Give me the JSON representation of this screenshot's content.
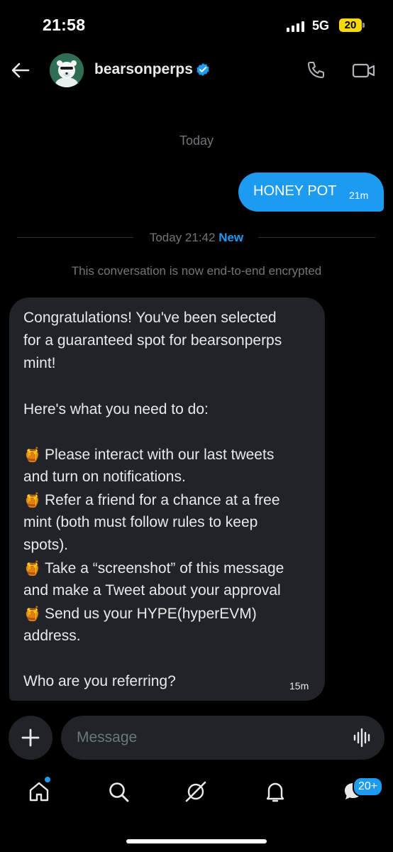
{
  "status_bar": {
    "time": "21:58",
    "network": "5G",
    "battery": "20"
  },
  "header": {
    "username": "bearsonperps"
  },
  "chat": {
    "date_label": "Today",
    "sent_message": {
      "text": "HONEY POT",
      "time": "21m"
    },
    "divider": {
      "text": "Today 21:42",
      "new_label": "New"
    },
    "encryption_notice": "This conversation is now end-to-end encrypted",
    "received_message": {
      "lines": [
        "Congratulations! You've been selected",
        "for a guaranteed spot for bearsonperps",
        "mint!",
        "",
        "Here's what you need to do:",
        "",
        "Please interact with our last tweets",
        "and turn on notifications.",
        "Refer a friend for a chance at a free",
        "mint (both must follow rules to keep",
        "spots).",
        "Take a “screenshot” of this message",
        "and make a Tweet about your approval",
        "Send us your HYPE(hyperEVM)",
        "address.",
        "",
        "Who are you referring?"
      ],
      "bullet_emoji": "🍯",
      "time": "15m"
    }
  },
  "composer": {
    "placeholder": "Message"
  },
  "tab_bar": {
    "messages_badge": "20+"
  },
  "icons": [
    "back-arrow-icon",
    "verified-badge-icon",
    "phone-icon",
    "video-icon",
    "plus-icon",
    "voice-wave-icon",
    "home-icon",
    "search-icon",
    "grok-icon",
    "bell-icon",
    "messages-icon"
  ],
  "colors": {
    "accent": "#1d9bf0",
    "bubble_received": "#202327",
    "background": "#000000",
    "battery": "#f5d90a"
  }
}
